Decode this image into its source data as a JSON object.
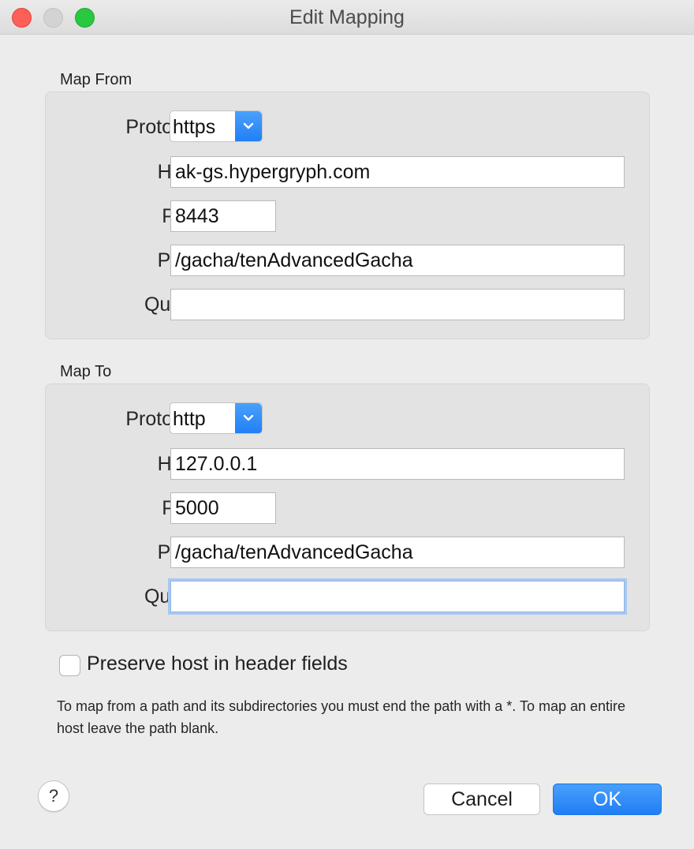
{
  "window": {
    "title": "Edit Mapping"
  },
  "map_from": {
    "label": "Map From",
    "protocol_label": "Protocol:",
    "protocol": "https",
    "host_label": "Host:",
    "host": "ak-gs.hypergryph.com",
    "port_label": "Port:",
    "port": "8443",
    "path_label": "Path:",
    "path": "/gacha/tenAdvancedGacha",
    "query_label": "Query:",
    "query": ""
  },
  "map_to": {
    "label": "Map To",
    "protocol_label": "Protocol:",
    "protocol": "http",
    "host_label": "Host:",
    "host": "127.0.0.1",
    "port_label": "Port:",
    "port": "5000",
    "path_label": "Path:",
    "path": "/gacha/tenAdvancedGacha",
    "query_label": "Query:",
    "query": ""
  },
  "preserve_host": {
    "label": "Preserve host in header fields",
    "checked": false
  },
  "hint": "To map from a path and its subdirectories you must end the path with a *. To map an entire host leave the path blank.",
  "buttons": {
    "help": "?",
    "cancel": "Cancel",
    "ok": "OK"
  },
  "colors": {
    "accent": "#1f7ef5",
    "close": "#fe5f57",
    "zoom": "#28c840"
  },
  "icons": {
    "dropdown": "chevron-down-icon",
    "help": "help-icon"
  }
}
